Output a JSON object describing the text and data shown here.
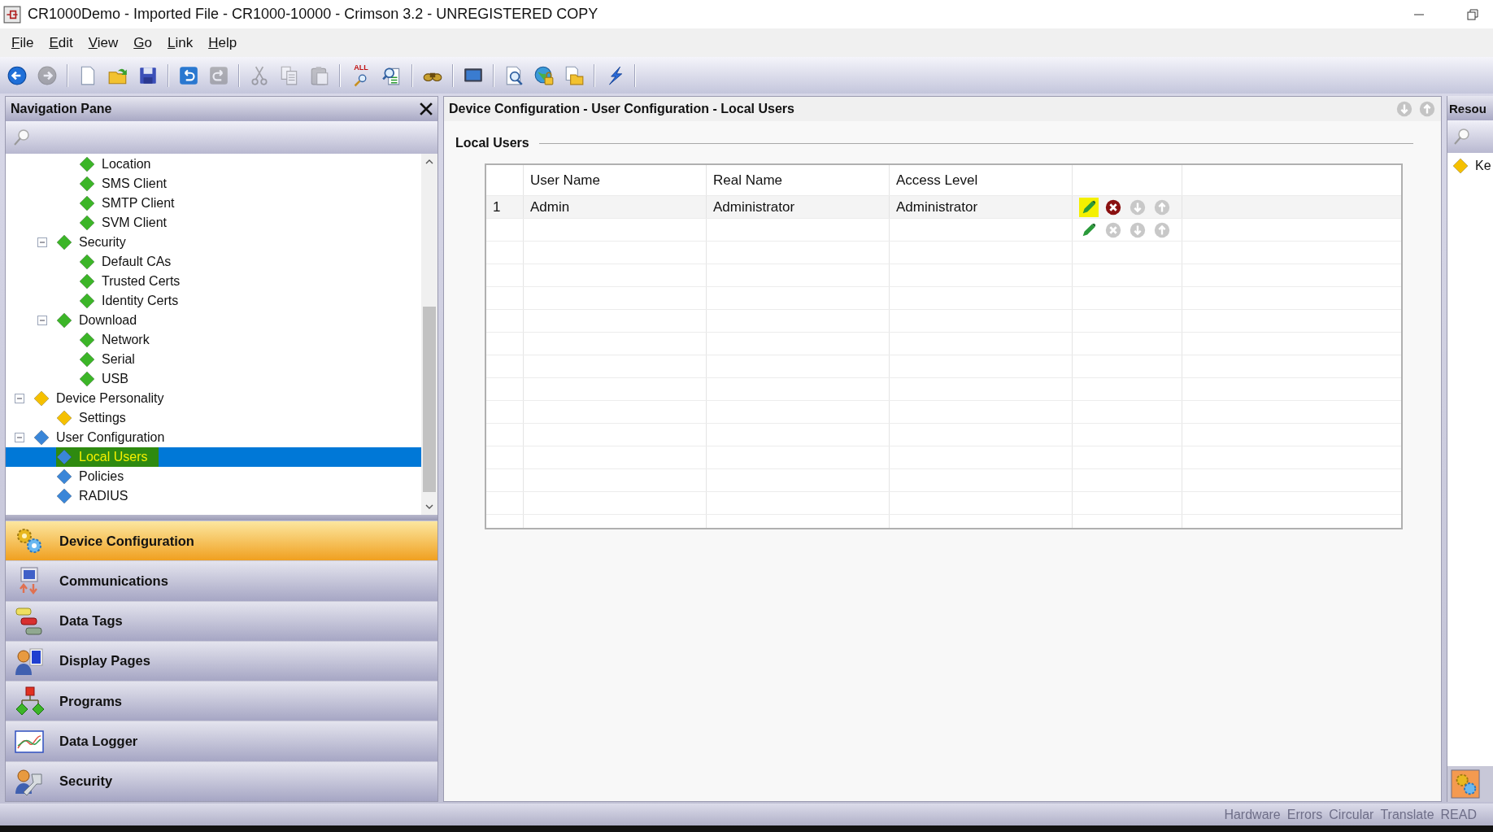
{
  "window": {
    "title": "CR1000Demo - Imported File - CR1000-10000 - Crimson 3.2 - UNREGISTERED COPY"
  },
  "menu": [
    "File",
    "Edit",
    "View",
    "Go",
    "Link",
    "Help"
  ],
  "toolbar": {
    "groups": [
      [
        {
          "disabled": false
        },
        {
          "disabled": true
        }
      ],
      [
        {
          "disabled": false
        },
        {
          "disabled": false
        },
        {
          "disabled": false
        }
      ],
      [
        {
          "disabled": false
        },
        {
          "disabled": true
        }
      ],
      [
        {
          "disabled": true
        },
        {
          "disabled": true
        },
        {
          "disabled": true
        }
      ],
      [
        {
          "disabled": false,
          "label": "ALL"
        },
        {
          "disabled": false
        }
      ],
      [
        {
          "disabled": false
        }
      ],
      [
        {
          "disabled": false
        }
      ],
      [
        {
          "disabled": false
        },
        {
          "disabled": false
        },
        {
          "disabled": false
        }
      ],
      [
        {
          "disabled": false
        }
      ]
    ]
  },
  "navigation": {
    "title": "Navigation Pane",
    "tree": [
      {
        "children": [
          {
            "children": [
              {
                "label": "Location",
                "color": "#3cb528",
                "selected": false,
                "highlighted": false
              },
              {
                "label": "SMS Client",
                "color": "#3cb528",
                "selected": false,
                "highlighted": false
              },
              {
                "label": "SMTP Client",
                "color": "#3cb528",
                "selected": false,
                "highlighted": false
              },
              {
                "label": "SVM Client",
                "color": "#3cb528",
                "selected": false,
                "highlighted": false
              }
            ]
          },
          {
            "label": "Security",
            "color": "#3cb528",
            "expanded": true,
            "selected": false,
            "highlighted": false,
            "children": [
              {
                "label": "Default CAs",
                "color": "#3cb528",
                "selected": false,
                "highlighted": false
              },
              {
                "label": "Trusted Certs",
                "color": "#3cb528",
                "selected": false,
                "highlighted": false
              },
              {
                "label": "Identity Certs",
                "color": "#3cb528",
                "selected": false,
                "highlighted": false
              }
            ]
          },
          {
            "label": "Download",
            "color": "#3cb528",
            "expanded": true,
            "selected": false,
            "highlighted": false,
            "children": [
              {
                "label": "Network",
                "color": "#3cb528",
                "selected": false,
                "highlighted": false
              },
              {
                "label": "Serial",
                "color": "#3cb528",
                "selected": false,
                "highlighted": false
              },
              {
                "label": "USB",
                "color": "#3cb528",
                "selected": false,
                "highlighted": false
              }
            ]
          }
        ]
      },
      {
        "label": "Device Personality",
        "color": "#f5c000",
        "expanded": true,
        "selected": false,
        "highlighted": false,
        "children": [
          {
            "label": "Settings",
            "color": "#f5c000",
            "selected": false,
            "highlighted": false
          }
        ]
      },
      {
        "label": "User Configuration",
        "color": "#3a86d8",
        "expanded": true,
        "selected": false,
        "highlighted": false,
        "children": [
          {
            "label": "Local Users",
            "color": "#3a86d8",
            "selected": true,
            "highlighted": true
          },
          {
            "label": "Policies",
            "color": "#3a86d8",
            "selected": false,
            "highlighted": false
          },
          {
            "label": "RADIUS",
            "color": "#3a86d8",
            "selected": false,
            "highlighted": false
          }
        ]
      }
    ],
    "categories": [
      {
        "label": "Device Configuration",
        "selected": true
      },
      {
        "label": "Communications",
        "selected": false
      },
      {
        "label": "Data Tags",
        "selected": false
      },
      {
        "label": "Display Pages",
        "selected": false
      },
      {
        "label": "Programs",
        "selected": false
      },
      {
        "label": "Data Logger",
        "selected": false
      },
      {
        "label": "Security",
        "selected": false
      }
    ]
  },
  "content": {
    "breadcrumb": "Device Configuration - User Configuration - Local Users",
    "section": "Local Users",
    "table": {
      "columns": [
        "User Name",
        "Real Name",
        "Access Level"
      ],
      "rows": [
        {
          "number": "1",
          "cells": [
            "Admin",
            "Administrator",
            "Administrator"
          ],
          "actions": [
            {
              "kind": "edit",
              "disabled": false,
              "highlighted": true
            },
            {
              "kind": "delete",
              "disabled": false,
              "highlighted": false
            },
            {
              "kind": "down",
              "disabled": true,
              "highlighted": false
            },
            {
              "kind": "up",
              "disabled": true,
              "highlighted": false
            }
          ]
        },
        {
          "actions": [
            {
              "kind": "edit",
              "disabled": false,
              "highlighted": false
            },
            {
              "kind": "delete",
              "disabled": true,
              "highlighted": false
            },
            {
              "kind": "down",
              "disabled": true,
              "highlighted": false
            },
            {
              "kind": "up",
              "disabled": true,
              "highlighted": false
            }
          ]
        }
      ]
    }
  },
  "resources": {
    "title": "Resou",
    "items": [
      "Ke"
    ]
  },
  "status_bar": [
    "Hardware",
    "Errors",
    "Circular",
    "Translate",
    "READ"
  ]
}
